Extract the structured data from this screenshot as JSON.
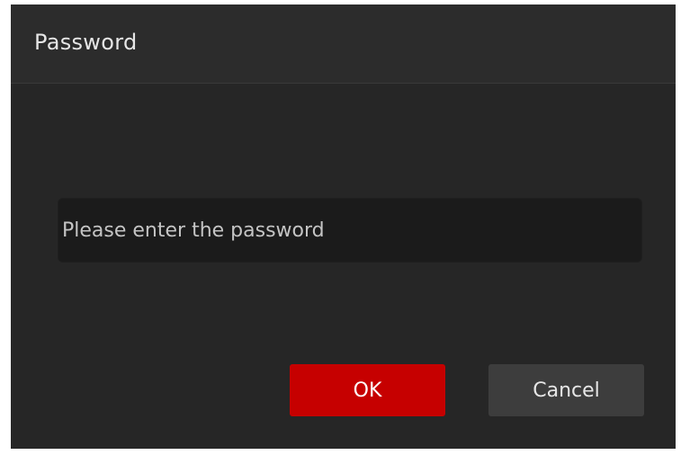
{
  "dialog": {
    "title": "Password",
    "password_field": {
      "value": "",
      "placeholder": "Please enter the password"
    },
    "buttons": {
      "ok_label": "OK",
      "cancel_label": "Cancel"
    }
  },
  "colors": {
    "dialog_background": "#262626",
    "titlebar_background": "#2c2c2c",
    "input_background": "#1b1b1b",
    "ok_button": "#c60000",
    "cancel_button": "#3d3d3d"
  }
}
